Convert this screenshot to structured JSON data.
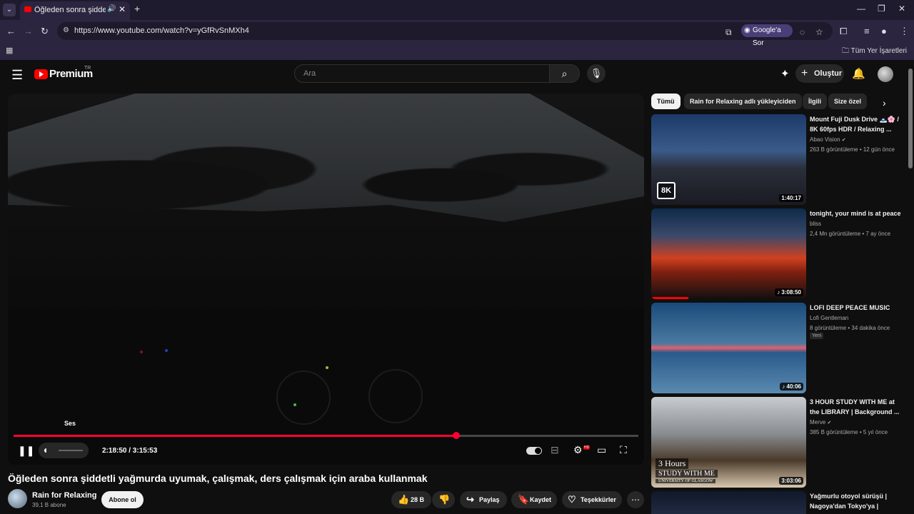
{
  "browser": {
    "tab_title": "Öğleden sonra şiddetli yağ",
    "tab_audio_icon": "speaker-icon",
    "url": "https://www.youtube.com/watch?v=yGfRvSnMXh4",
    "google_ask_label": "Google'a Sor",
    "bookmarks_all_label": "Tüm Yer İşaretleri",
    "theme_color": "#2b2540"
  },
  "youtube": {
    "logo_text": "Premium",
    "logo_country": "TR",
    "search_placeholder": "Ara",
    "create_label": "Oluştur",
    "brand_red": "#ff0000"
  },
  "player": {
    "tooltip": "Ses",
    "current_time": "2:18:50",
    "duration": "3:15:53",
    "time_display": "2:18:50 / 3:15:53",
    "progress_fraction": 0.709,
    "volume_fraction": 0.0,
    "autoplay_on": true,
    "quality_badge": "HD",
    "progress_color": "#ff0033"
  },
  "video": {
    "title": "Öğleden sonra şiddetli yağmurda uyumak, çalışmak, ders çalışmak için araba kullanmak",
    "channel": "Rain for Relaxing",
    "subscribers": "39,1 B abone",
    "subscribe_label": "Abone ol",
    "likes": "28 B",
    "share_label": "Paylaş",
    "save_label": "Kaydet",
    "thanks_label": "Teşekkürler"
  },
  "chips": [
    {
      "label": "Tümü",
      "active": true
    },
    {
      "label": "Rain for Relaxing adlı yükleyiciden",
      "active": false
    },
    {
      "label": "İlgili",
      "active": false
    },
    {
      "label": "Size özel",
      "active": false
    }
  ],
  "recommendations": [
    {
      "title": "Mount Fuji Dusk Drive 🗻🌸 / 8K 60fps HDR / Relaxing ...",
      "channel": "Abao Vision",
      "verified": true,
      "views": "263 B görüntüleme",
      "age": "12 gün önce",
      "duration": "1:40:17",
      "badge_8k": "8K",
      "is_new": false,
      "watched_fraction": 0
    },
    {
      "title": "tonight, your mind is at peace",
      "channel": "bliss",
      "verified": false,
      "views": "2,4 Mn görüntüleme",
      "age": "7 ay önce",
      "duration": "3:08:50",
      "music": true,
      "is_new": false,
      "watched_fraction": 0.24
    },
    {
      "title": "LOFI DEEP PEACE MUSIC",
      "channel": "Lofi Gentleman",
      "verified": false,
      "views": "8 görüntüleme",
      "age": "34 dakika önce",
      "duration": "40:06",
      "music": true,
      "is_new": true,
      "new_label": "Yeni",
      "watched_fraction": 0
    },
    {
      "title": "3 HOUR STUDY WITH ME at the LIBRARY | Background ...",
      "channel": "Merve",
      "verified": true,
      "views": "385 B görüntüleme",
      "age": "5 yıl önce",
      "duration": "3:03:06",
      "thumb_text_1": "3 Hours",
      "thumb_text_2": "STUDY WITH ME",
      "thumb_text_3": "UNIVERSITY OF GLASGOW",
      "is_new": false,
      "watched_fraction": 0
    },
    {
      "title": "Yağmurlu otoyol sürüşü | Nagoya'dan Tokyo'ya | Şafağ...",
      "channel": "",
      "views": "",
      "age": ""
    }
  ]
}
